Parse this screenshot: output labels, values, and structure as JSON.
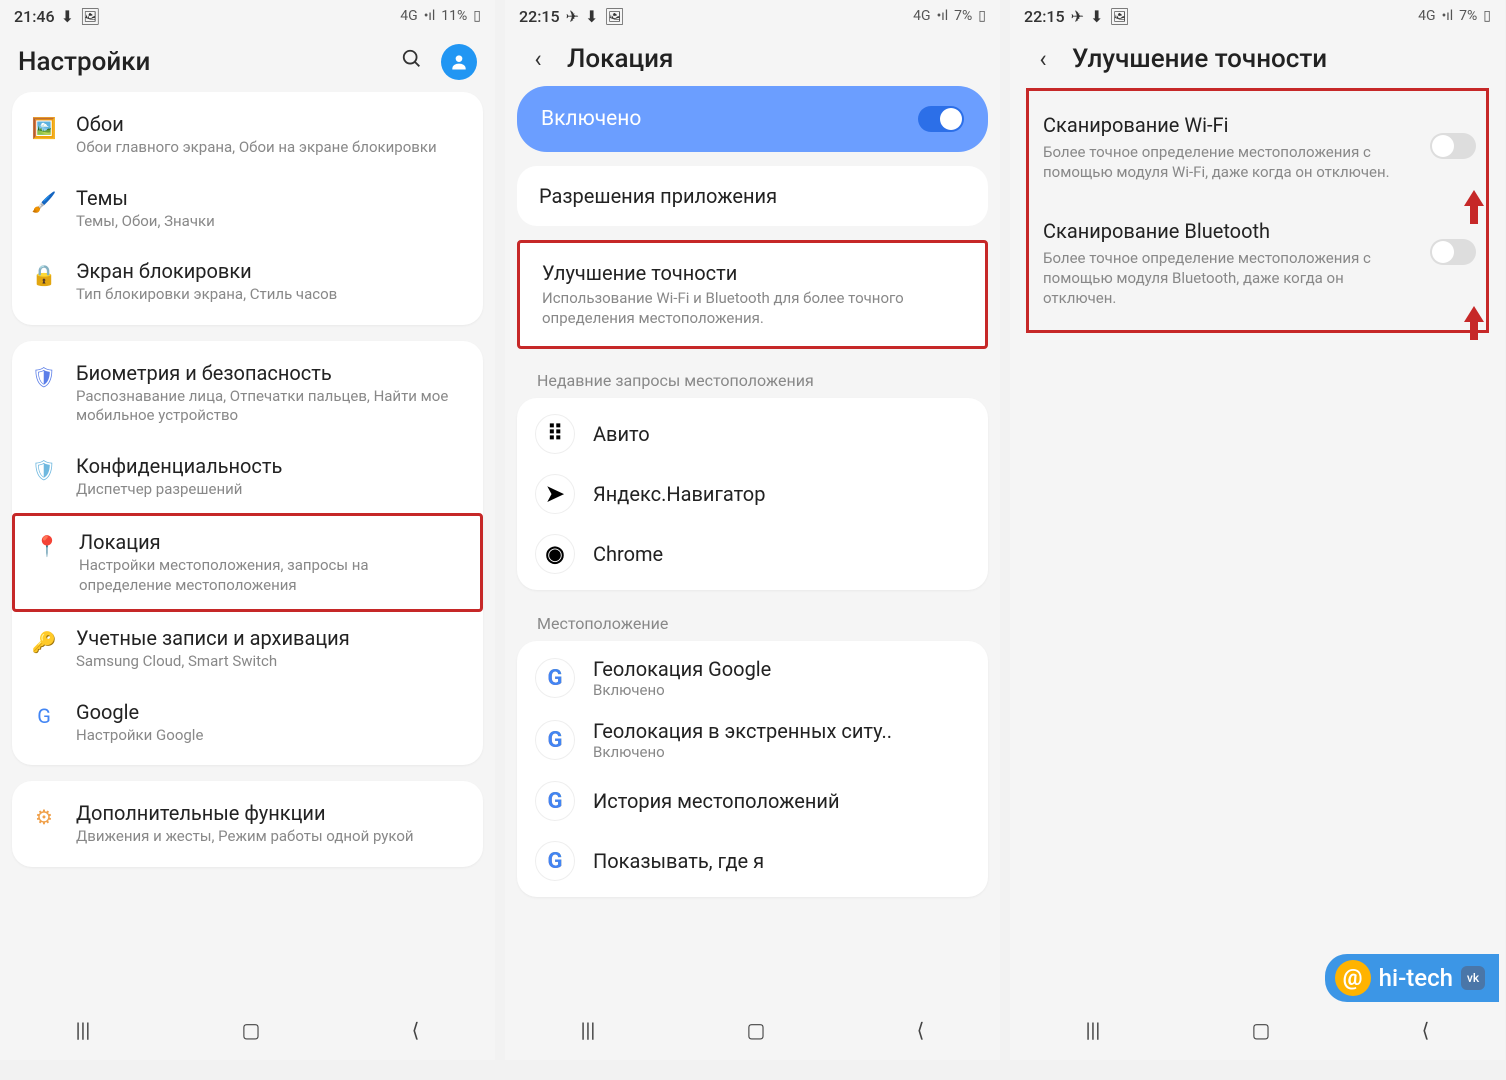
{
  "screen1": {
    "status": {
      "time": "21:46",
      "net": "4G",
      "signal": "•ıl",
      "battery": "11%"
    },
    "header": {
      "title": "Настройки"
    },
    "groups": [
      {
        "items": [
          {
            "icon": "🖼️",
            "color": "#e39bb1",
            "title": "Обои",
            "sub": "Обои главного экрана, Обои на экране блокировки"
          },
          {
            "icon": "🖌️",
            "color": "#b178c7",
            "title": "Темы",
            "sub": "Темы, Обои, Значки"
          },
          {
            "icon": "🔒",
            "color": "#5ec1a4",
            "title": "Экран блокировки",
            "sub": "Тип блокировки экрана, Стиль часов"
          }
        ]
      },
      {
        "items": [
          {
            "icon": "🛡",
            "color": "#5b7ee8",
            "title": "Биометрия и безопасность",
            "sub": "Распознавание лица, Отпечатки пальцев, Найти мое мобильное устройство"
          },
          {
            "icon": "🛡",
            "color": "#6fb8df",
            "title": "Конфиденциальность",
            "sub": "Диспетчер разрешений"
          },
          {
            "icon": "📍",
            "color": "#4caf50",
            "title": "Локация",
            "sub": "Настройки местоположения, запросы на определение местоположения",
            "hl": true
          },
          {
            "icon": "🔑",
            "color": "#3d7be0",
            "title": "Учетные записи и архивация",
            "sub": "Samsung Cloud, Smart Switch"
          },
          {
            "icon": "G",
            "color": "#4285f4",
            "title": "Google",
            "sub": "Настройки Google"
          }
        ]
      },
      {
        "items": [
          {
            "icon": "⚙",
            "color": "#f0a04a",
            "title": "Дополнительные функции",
            "sub": "Движения и жесты, Режим работы одной рукой"
          }
        ]
      }
    ]
  },
  "screen2": {
    "status": {
      "time": "22:15",
      "net": "4G",
      "signal": "•ıl",
      "battery": "7%"
    },
    "header": {
      "title": "Локация"
    },
    "enabled": "Включено",
    "perm_title": "Разрешения приложения",
    "improve": {
      "title": "Улучшение точности",
      "sub": "Использование Wi-Fi и Bluetooth для более точного определения местоположения."
    },
    "recent_label": "Недавние запросы местоположения",
    "apps": [
      {
        "name": "Авито",
        "g": false,
        "icon": "⠿"
      },
      {
        "name": "Яндекс.Навигатор",
        "g": false,
        "icon": "➤"
      },
      {
        "name": "Chrome",
        "g": false,
        "icon": "◉"
      }
    ],
    "loc_label": "Местоположение",
    "services": [
      {
        "name": "Геолокация Google",
        "sub": "Включено",
        "g": true
      },
      {
        "name": "Геолокация в экстренных ситу..",
        "sub": "Включено",
        "g": true
      },
      {
        "name": "История местоположений",
        "g": true
      },
      {
        "name": "Показывать, где я",
        "g": true
      }
    ]
  },
  "screen3": {
    "status": {
      "time": "22:15",
      "net": "4G",
      "signal": "•ıl",
      "battery": "7%"
    },
    "header": {
      "title": "Улучшение точности"
    },
    "items": [
      {
        "title": "Сканирование Wi-Fi",
        "sub": "Более точное определение местоположения с помощью модуля Wi-Fi, даже когда он отключен."
      },
      {
        "title": "Сканирование Bluetooth",
        "sub": "Более точное определение местоположения с помощью модуля Bluetooth, даже когда он отключен."
      }
    ]
  },
  "watermark": {
    "text": "hi-tech"
  }
}
